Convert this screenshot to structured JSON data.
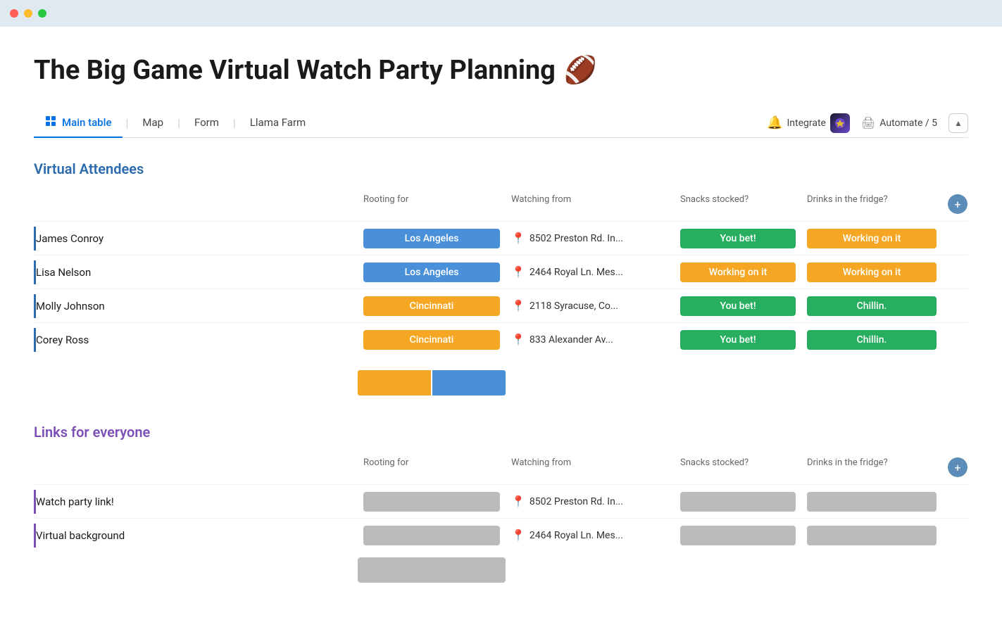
{
  "window": {
    "dots": [
      "red",
      "yellow",
      "green"
    ]
  },
  "page": {
    "title": "The Big Game Virtual Watch Party Planning",
    "emoji": "🏈"
  },
  "tabs": {
    "items": [
      {
        "label": "Main table",
        "active": true
      },
      {
        "label": "Map",
        "active": false
      },
      {
        "label": "Form",
        "active": false
      },
      {
        "label": "Llama Farm",
        "active": false
      }
    ],
    "integrate_label": "Integrate",
    "automate_label": "Automate / 5"
  },
  "virtual_attendees": {
    "section_title": "Virtual Attendees",
    "columns": [
      "Rooting for",
      "Watching from",
      "Snacks stocked?",
      "Drinks in the fridge?"
    ],
    "rows": [
      {
        "name": "James Conroy",
        "rooting_for": "Los Angeles",
        "rooting_color": "blue",
        "watching_from": "8502 Preston Rd. In...",
        "snacks": "You bet!",
        "snacks_color": "green",
        "drinks": "Working on it",
        "drinks_color": "orange"
      },
      {
        "name": "Lisa Nelson",
        "rooting_for": "Los Angeles",
        "rooting_color": "blue",
        "watching_from": "2464 Royal Ln. Mes...",
        "snacks": "Working on it",
        "snacks_color": "orange",
        "drinks": "Working on it",
        "drinks_color": "orange"
      },
      {
        "name": "Molly Johnson",
        "rooting_for": "Cincinnati",
        "rooting_color": "orange",
        "watching_from": "2118 Syracuse, Co...",
        "snacks": "You bet!",
        "snacks_color": "green",
        "drinks": "Chillin.",
        "drinks_color": "green"
      },
      {
        "name": "Corey Ross",
        "rooting_for": "Cincinnati",
        "rooting_color": "orange",
        "watching_from": "833  Alexander Av...",
        "snacks": "You bet!",
        "snacks_color": "green",
        "drinks": "Chillin.",
        "drinks_color": "green"
      }
    ]
  },
  "links_for_everyone": {
    "section_title": "Links for everyone",
    "columns": [
      "Rooting for",
      "Watching from",
      "Snacks stocked?",
      "Drinks in the fridge?"
    ],
    "rows": [
      {
        "name": "Watch party link!",
        "watching_from": "8502 Preston Rd. In..."
      },
      {
        "name": "Virtual background",
        "watching_from": "2464 Royal Ln. Mes..."
      }
    ]
  }
}
